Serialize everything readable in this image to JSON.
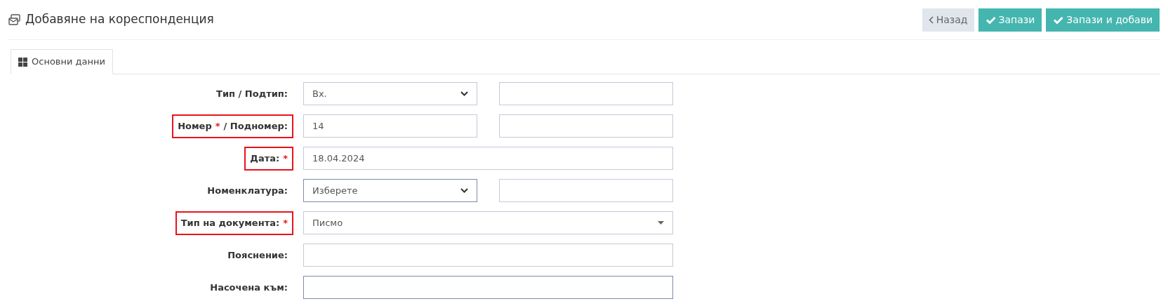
{
  "header": {
    "title": "Добавяне на кореспонденция"
  },
  "buttons": [
    {
      "kind": "back",
      "label": "Назад"
    },
    {
      "kind": "save",
      "label": "Запази"
    },
    {
      "kind": "save",
      "label": "Запази и добави"
    }
  ],
  "tabs": [
    {
      "label": "Основни данни",
      "selected": true
    }
  ],
  "form": [
    {
      "label": "Тип / Подтип:",
      "highlighted": false,
      "fields": [
        {
          "kind": "select",
          "value": "Вх.",
          "focused": false
        },
        {
          "kind": "input",
          "focused": false
        }
      ]
    },
    {
      "label": "Номер",
      "required_mark": "*",
      "label_suffix": "/ Подномер:",
      "highlighted": true,
      "fields": [
        {
          "kind": "input",
          "value": "14",
          "focused": false
        },
        {
          "kind": "input",
          "focused": false
        }
      ]
    },
    {
      "label": "Дата:",
      "required_mark": "*",
      "highlighted": true,
      "fields": [
        {
          "kind": "wide-input",
          "value": "18.04.2024",
          "focused": false
        }
      ]
    },
    {
      "label": "Номенклатура:",
      "highlighted": false,
      "fields": [
        {
          "kind": "select",
          "value": "Изберете",
          "focused": true
        },
        {
          "kind": "input",
          "focused": false
        }
      ]
    },
    {
      "label": "Тип на документа:",
      "required_mark": "*",
      "highlighted": true,
      "fields": [
        {
          "kind": "wide-select",
          "value": "Писмо",
          "focused": false
        }
      ]
    },
    {
      "label": "Пояснение:",
      "highlighted": false,
      "fields": [
        {
          "kind": "wide-input",
          "focused": false
        }
      ]
    },
    {
      "label": "Насочена към:",
      "highlighted": false,
      "fields": [
        {
          "kind": "wide-input",
          "focused": true
        }
      ]
    }
  ]
}
